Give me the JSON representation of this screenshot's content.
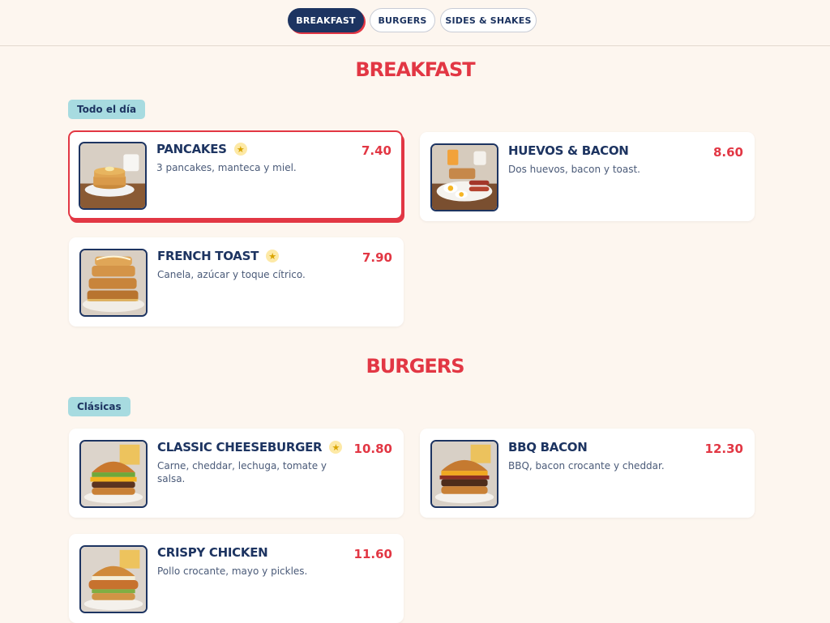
{
  "nav": {
    "tabs": [
      {
        "label": "BREAKFAST",
        "active": true
      },
      {
        "label": "BURGERS",
        "active": false
      },
      {
        "label": "SIDES & SHAKES",
        "active": false
      }
    ]
  },
  "sections": [
    {
      "title": "BREAKFAST",
      "tag": "Todo el día",
      "items": [
        {
          "name": "PANCAKES",
          "featured": true,
          "desc": "3 pancakes, manteca y miel.",
          "price": "7.40",
          "image_icon": "pancakes-image",
          "selected": true
        },
        {
          "name": "HUEVOS & BACON",
          "featured": false,
          "desc": "Dos huevos, bacon y toast.",
          "price": "8.60",
          "image_icon": "eggs-bacon-image",
          "selected": false
        },
        {
          "name": "FRENCH TOAST",
          "featured": true,
          "desc": "Canela, azúcar y toque cítrico.",
          "price": "7.90",
          "image_icon": "french-toast-image",
          "selected": false
        }
      ]
    },
    {
      "title": "BURGERS",
      "tag": "Clásicas",
      "items": [
        {
          "name": "CLASSIC CHEESEBURGER",
          "featured": true,
          "desc": "Carne, cheddar, lechuga, tomate y salsa.",
          "price": "10.80",
          "image_icon": "cheeseburger-image",
          "selected": false
        },
        {
          "name": "BBQ BACON",
          "featured": false,
          "desc": "BBQ, bacon crocante y cheddar.",
          "price": "12.30",
          "image_icon": "bbq-burger-image",
          "selected": false
        },
        {
          "name": "CRISPY CHICKEN",
          "featured": false,
          "desc": "Pollo crocante, mayo y pickles.",
          "price": "11.60",
          "image_icon": "chicken-burger-image",
          "selected": false
        }
      ]
    }
  ],
  "featured_icon": "star-icon",
  "colors": {
    "background": "#fdf6ef",
    "navy": "#1d3461",
    "accent_red": "#e23744",
    "tag_bg": "#a7dbe0",
    "star_bg": "#fde9a6"
  }
}
